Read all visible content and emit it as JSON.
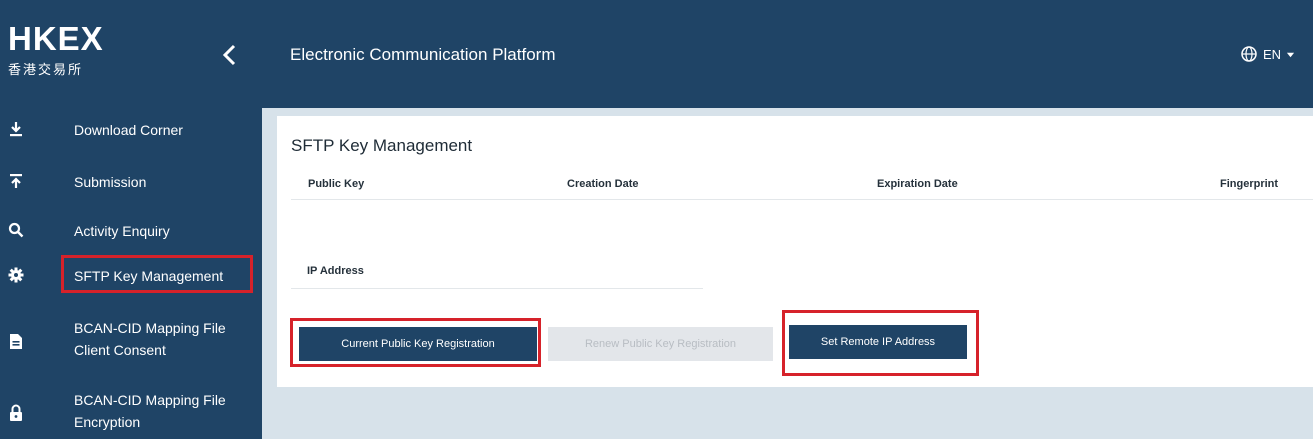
{
  "brand": {
    "logo_main": "HKEX",
    "logo_sub": "香港交易所"
  },
  "header": {
    "title": "Electronic Communication Platform",
    "language": "EN"
  },
  "sidebar": {
    "items": [
      {
        "label": "Download Corner",
        "icon": "download-icon"
      },
      {
        "label": "Submission",
        "icon": "upload-icon"
      },
      {
        "label": "Activity Enquiry",
        "icon": "search-icon"
      },
      {
        "label": "SFTP Key Management",
        "icon": "gear-icon",
        "selected": true
      },
      {
        "label_line1": "BCAN-CID Mapping File",
        "label_line2": "Client Consent",
        "icon": "document-icon"
      },
      {
        "label_line1": "BCAN-CID Mapping File",
        "label_line2": "Encryption",
        "icon": "lock-icon"
      }
    ]
  },
  "main": {
    "title": "SFTP Key Management",
    "columns": [
      "Public Key",
      "Creation Date",
      "Expiration Date",
      "Fingerprint"
    ],
    "ip_label": "IP Address",
    "buttons": {
      "current_registration": "Current Public Key Registration",
      "renew_registration": "Renew Public Key Registration",
      "set_remote_ip": "Set Remote IP Address"
    }
  },
  "colors": {
    "primary": "#1f4466",
    "highlight": "#d6222a",
    "content_bg": "#d7e2ea"
  }
}
